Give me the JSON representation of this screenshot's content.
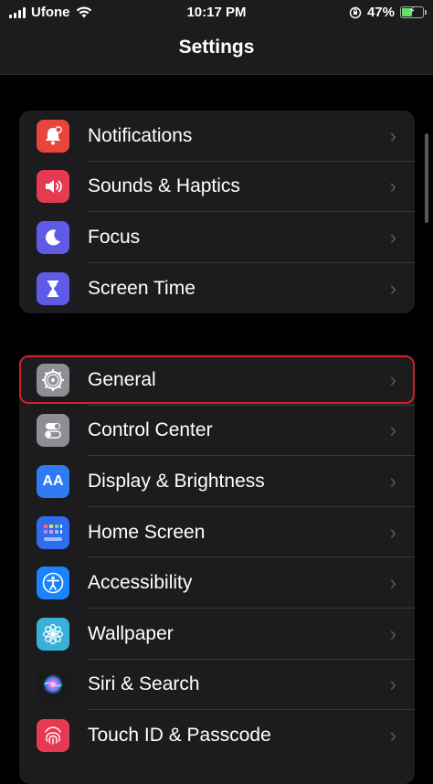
{
  "status_bar": {
    "carrier": "Ufone",
    "time": "10:17 PM",
    "battery": "47%",
    "battery_level": 0.47
  },
  "header": {
    "title": "Settings"
  },
  "groups": [
    {
      "items": [
        {
          "label": "Notifications",
          "icon": "bell-icon",
          "color": "#e8453c"
        },
        {
          "label": "Sounds & Haptics",
          "icon": "speaker-icon",
          "color": "#e63952"
        },
        {
          "label": "Focus",
          "icon": "moon-icon",
          "color": "#5e5ce6"
        },
        {
          "label": "Screen Time",
          "icon": "hourglass-icon",
          "color": "#5e5ce6"
        }
      ]
    },
    {
      "items": [
        {
          "label": "General",
          "icon": "gear-icon",
          "color": "#8e8e93",
          "highlighted": true
        },
        {
          "label": "Control Center",
          "icon": "toggles-icon",
          "color": "#8e8e93"
        },
        {
          "label": "Display & Brightness",
          "icon": "text-size-icon",
          "color": "#2f7bf5"
        },
        {
          "label": "Home Screen",
          "icon": "app-grid-icon",
          "color": "#2f6cf0"
        },
        {
          "label": "Accessibility",
          "icon": "accessibility-icon",
          "color": "#1a84ff"
        },
        {
          "label": "Wallpaper",
          "icon": "flower-icon",
          "color": "#38b0d8"
        },
        {
          "label": "Siri & Search",
          "icon": "siri-icon",
          "color": "#222"
        },
        {
          "label": "Touch ID & Passcode",
          "icon": "fingerprint-icon",
          "color": "#e63952"
        }
      ]
    }
  ],
  "icon_text": {
    "display": "AA"
  }
}
